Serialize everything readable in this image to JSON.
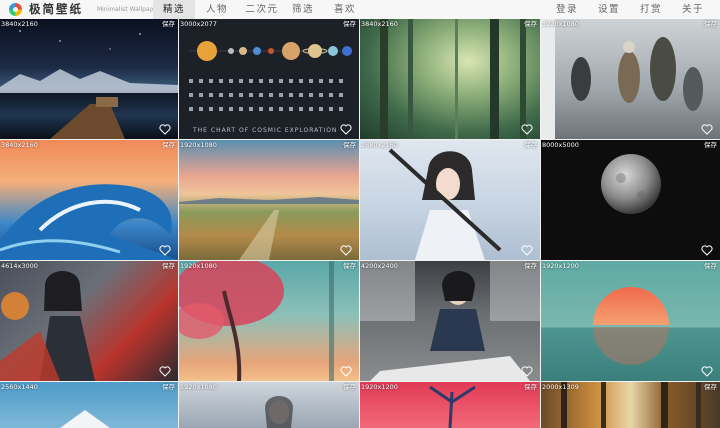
{
  "app": {
    "name": "极简壁纸",
    "subtitle": "Minimalist Wallpaper"
  },
  "nav": {
    "tabs": [
      {
        "label": "精选",
        "active": true
      },
      {
        "label": "人物"
      },
      {
        "label": "二次元"
      },
      {
        "label": "筛选"
      },
      {
        "label": "喜欢"
      }
    ],
    "right": [
      {
        "label": "登录"
      },
      {
        "label": "设置"
      },
      {
        "label": "打赏"
      },
      {
        "label": "关于"
      }
    ]
  },
  "save_label": "保存",
  "wallpapers": [
    {
      "resolution": "3840x2160",
      "subject": "night lake pier"
    },
    {
      "resolution": "3000x2077",
      "subject": "chart of cosmic exploration"
    },
    {
      "resolution": "3840x2160",
      "subject": "foggy forest"
    },
    {
      "resolution": "1920x1080",
      "subject": "costumed figures"
    },
    {
      "resolution": "3840x2160",
      "subject": "painted ocean wave"
    },
    {
      "resolution": "1920x1080",
      "subject": "autumn valley at sunset"
    },
    {
      "resolution": "2880x2160",
      "subject": "girl with sword"
    },
    {
      "resolution": "8000x5000",
      "subject": "moon"
    },
    {
      "resolution": "4614x3000",
      "subject": "fantasy warrior"
    },
    {
      "resolution": "1920x1080",
      "subject": "red tree"
    },
    {
      "resolution": "4200x2400",
      "subject": "woman at window"
    },
    {
      "resolution": "1920x1200",
      "subject": "sun over sea"
    },
    {
      "resolution": "2560x1440",
      "subject": "snowy mountain"
    },
    {
      "resolution": "1920x1080",
      "subject": "girl in snow"
    },
    {
      "resolution": "1920x1200",
      "subject": "red blossoms"
    },
    {
      "resolution": "2000x1309",
      "subject": "forest trunks"
    }
  ],
  "poster_text": "THE CHART OF COSMIC EXPLORATION",
  "colors": {
    "accent": "#ffffff",
    "active_tab_bg": "#e4e4e4",
    "topbar_bg": "#f7f7f7"
  }
}
